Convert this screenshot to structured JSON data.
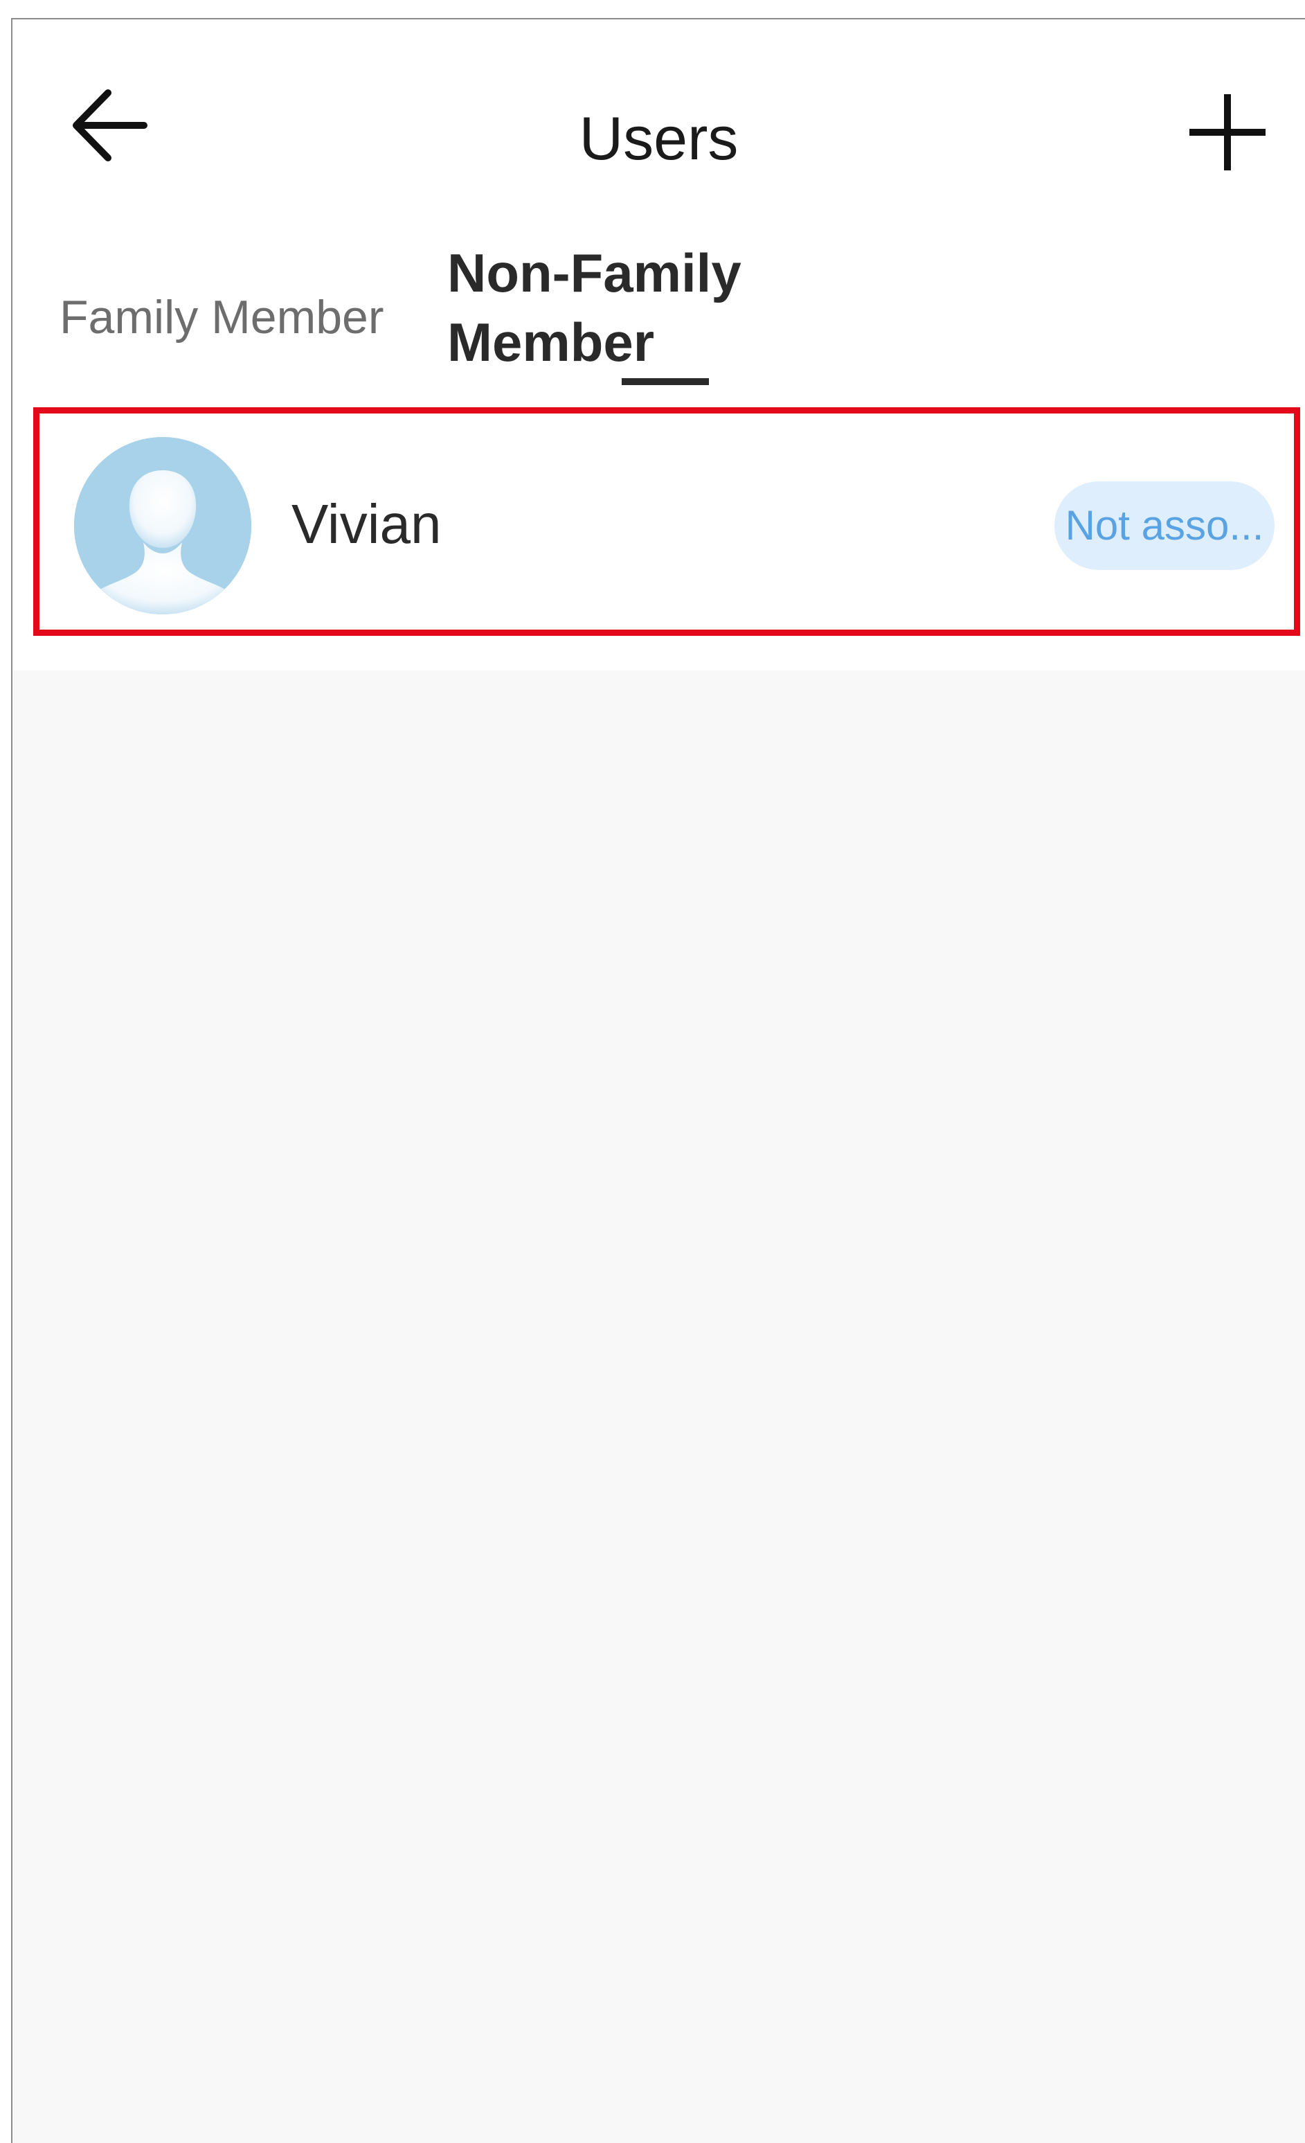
{
  "header": {
    "title": "Users",
    "back_icon": "arrow-left-icon",
    "add_icon": "plus-icon"
  },
  "tabs": [
    {
      "label": "Family Member",
      "active": false
    },
    {
      "label": "Non-Family Member",
      "active": true
    }
  ],
  "users": [
    {
      "name": "Vivian",
      "avatar_icon": "default-avatar-icon",
      "status": "Not asso..."
    }
  ],
  "colors": {
    "highlight_border": "#e4081b",
    "status_text": "#5aa3e3",
    "status_bg": "#dfeefd",
    "avatar_bg": "#a8d2ea"
  }
}
